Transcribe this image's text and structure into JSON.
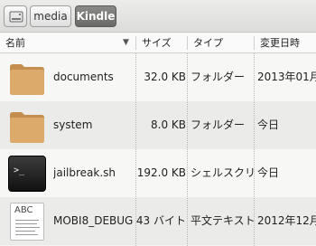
{
  "path_bar": {
    "buttons": [
      {
        "label": "",
        "icon": "drive-icon"
      },
      {
        "label": "media"
      },
      {
        "label": "Kindle",
        "active": true
      }
    ]
  },
  "columns": {
    "name": "名前",
    "size": "サイズ",
    "type": "タイプ",
    "date": "変更日時",
    "sort_indicator": "▼"
  },
  "files": [
    {
      "name": "documents",
      "size": "32.0 KB",
      "type": "フォルダー",
      "date": "2013年01月",
      "icon": "folder-icon"
    },
    {
      "name": "system",
      "size": "8.0 KB",
      "type": "フォルダー",
      "date": "今日",
      "icon": "folder-icon"
    },
    {
      "name": "jailbreak.sh",
      "size": "192.0 KB",
      "type": "シェルスクリプ",
      "date": "今日",
      "icon": "terminal-icon",
      "icon_text": ">_"
    },
    {
      "name": "MOBI8_DEBUG",
      "size": "43 バイト",
      "type": "平文テキスト",
      "date": "2012年12月(",
      "icon": "text-document-icon",
      "icon_text": "ABC"
    }
  ],
  "colors": {
    "folder": "#d9a868",
    "active_button": "#6a6a68"
  }
}
